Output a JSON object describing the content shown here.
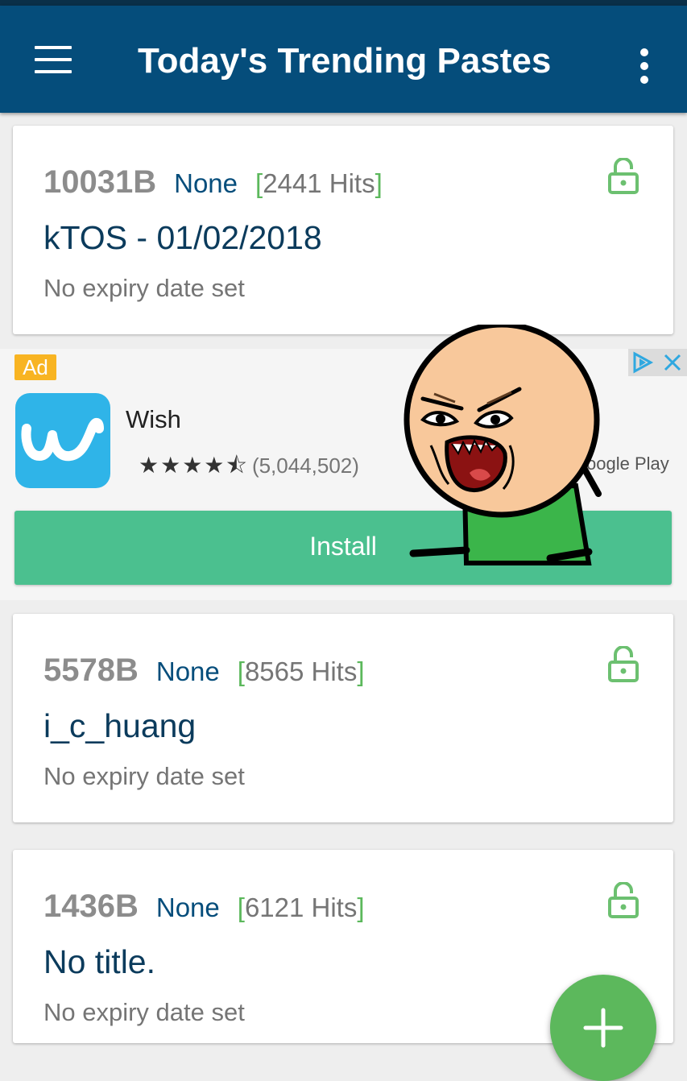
{
  "app_bar": {
    "title": "Today's Trending Pastes",
    "menu_icon": "hamburger-menu-icon",
    "overflow_icon": "more-vertical-icon",
    "color": "#054d7b"
  },
  "pastes": [
    {
      "size": "10031B",
      "syntax": "None",
      "bracket_open": "[",
      "hits": "2441 Hits",
      "bracket_close": "]",
      "title": "kTOS - 01/02/2018",
      "expiry": "No expiry date set",
      "icon": "unlocked-padlock-icon"
    },
    {
      "size": "5578B",
      "syntax": "None",
      "bracket_open": "[",
      "hits": "8565 Hits",
      "bracket_close": "]",
      "title": "i_c_huang",
      "expiry": "No expiry date set",
      "icon": "unlocked-padlock-icon"
    },
    {
      "size": "1436B",
      "syntax": "None",
      "bracket_open": "[",
      "hits": "6121 Hits",
      "bracket_close": "]",
      "title": "No title.",
      "expiry": "No expiry date set",
      "icon": "unlocked-padlock-icon"
    }
  ],
  "ad": {
    "badge": "Ad",
    "app_name": "Wish",
    "stars": "★★★★⯪",
    "rating_value": 4.5,
    "rating_count": "(5,044,502)",
    "store_fragment": "oogle Play",
    "install_label": "Install",
    "app_icon": "wish-app-icon",
    "choices_icon": "adchoices-icon",
    "close_icon": "close-icon",
    "button_color": "#4bc08f"
  },
  "overlay": {
    "icon": "angry-cartoon-face-sticker"
  },
  "fab": {
    "icon": "plus-icon",
    "color": "#5cb85c"
  }
}
